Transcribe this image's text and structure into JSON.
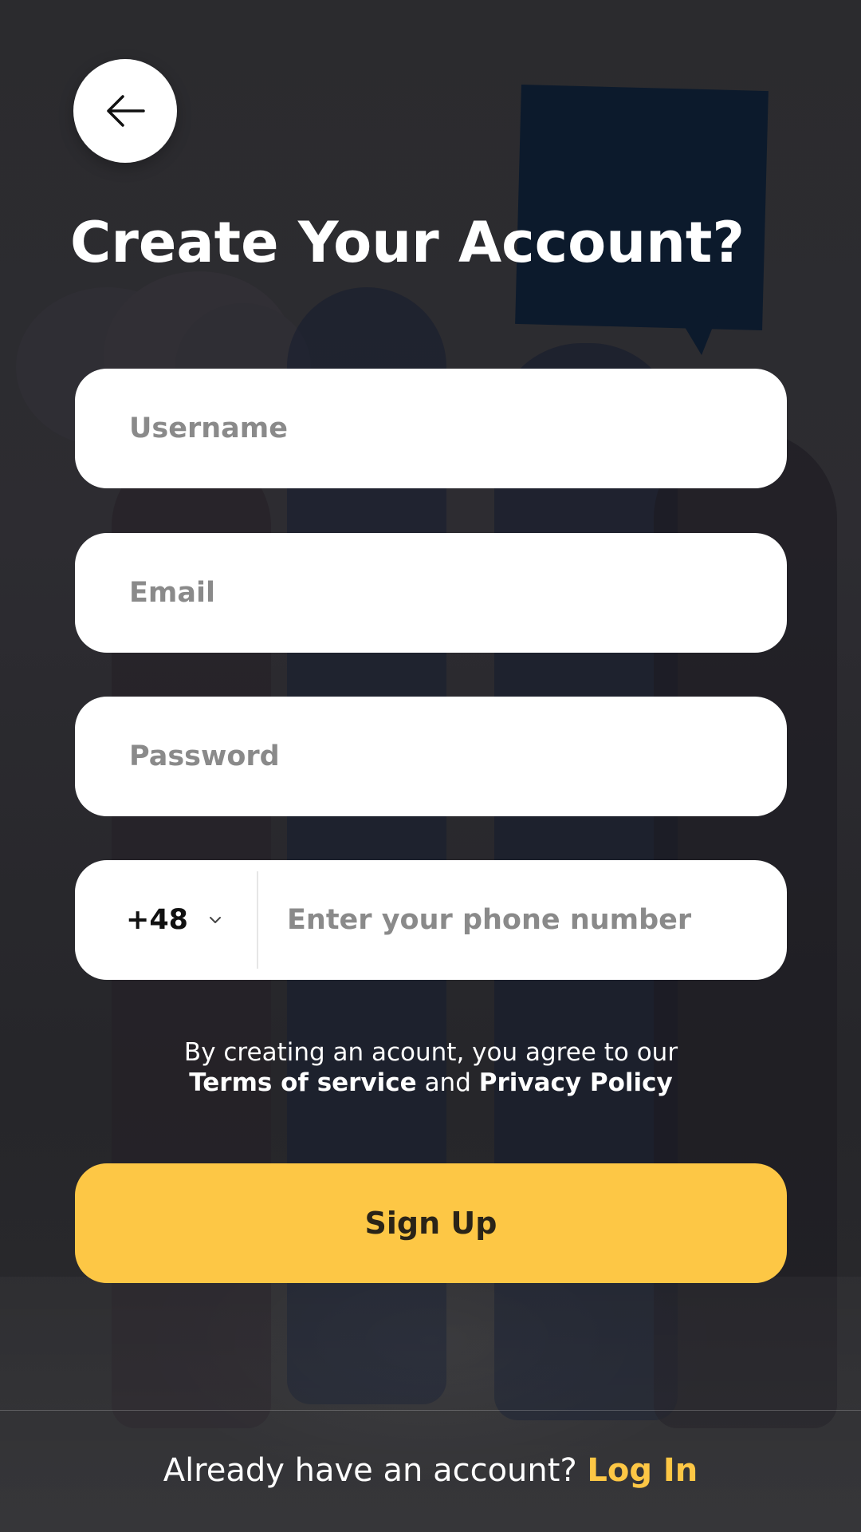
{
  "header": {
    "back_icon": "arrow-left-icon",
    "title": "Create Your Account?"
  },
  "form": {
    "username": {
      "placeholder": "Username",
      "value": ""
    },
    "email": {
      "placeholder": "Email",
      "value": ""
    },
    "password": {
      "placeholder": "Password",
      "value": ""
    },
    "phone": {
      "country_code": "+48",
      "country_icon": "chevron-down-icon",
      "placeholder": "Enter your phone number",
      "value": ""
    }
  },
  "terms": {
    "line1": "By creating an acount, you agree to our",
    "terms_link": "Terms of service",
    "conjunction": "and",
    "privacy_link": "Privacy Policy"
  },
  "actions": {
    "signup_label": "Sign Up"
  },
  "footer": {
    "prompt": "Already have an account?",
    "login_link": "Log In"
  },
  "colors": {
    "accent": "#fdc745",
    "background": "#2a2a2d",
    "field": "#ffffff",
    "placeholder": "#8a8a8a"
  }
}
